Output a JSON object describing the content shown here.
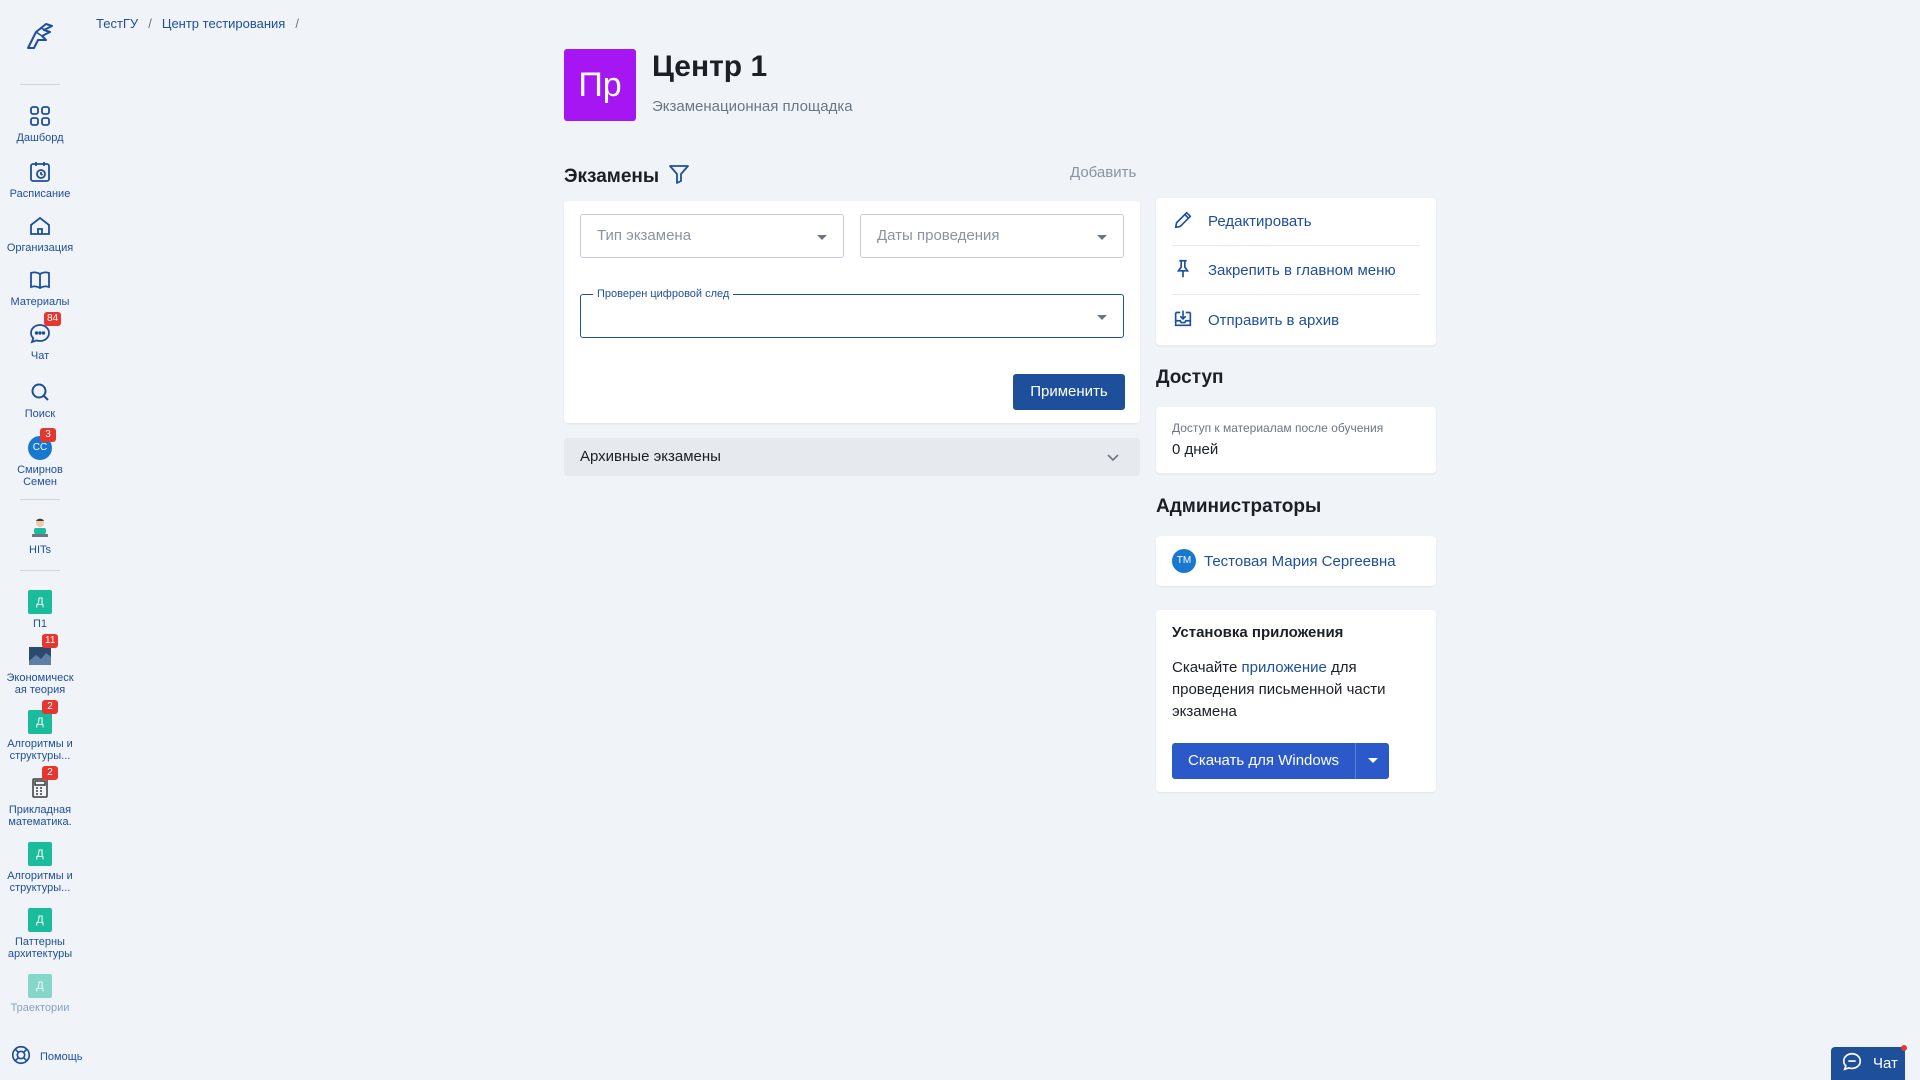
{
  "breadcrumb": {
    "items": [
      "ТестГУ",
      "Центр тестирования"
    ],
    "separator": "/"
  },
  "sidebar": {
    "nav": [
      {
        "label": "Дашборд",
        "icon": "grid-icon"
      },
      {
        "label": "Расписание",
        "icon": "calendar-clock-icon"
      },
      {
        "label": "Организация",
        "icon": "home-icon"
      },
      {
        "label": "Материалы",
        "icon": "book-icon"
      },
      {
        "label": "Чат",
        "icon": "chat-icon",
        "badge": "84"
      },
      {
        "label": "Поиск",
        "icon": "search-icon"
      },
      {
        "label1": "Смирнов",
        "label2": "Семен",
        "avatar": "СС",
        "badge": "3"
      },
      {
        "label": "HITs",
        "icon": "mascot-icon"
      }
    ],
    "courses": [
      {
        "line1": "П1",
        "line2": "",
        "initial": "Д"
      },
      {
        "line1": "Экономическ",
        "line2": "ая теория",
        "initial": "",
        "badge": "11"
      },
      {
        "line1": "Алгоритмы и",
        "line2": "структуры...",
        "initial": "Д",
        "badge": "2"
      },
      {
        "line1": "Прикладная",
        "line2": "математика.",
        "initial": "",
        "badge": "2"
      },
      {
        "line1": "Алгоритмы и",
        "line2": "структуры...",
        "initial": "Д"
      },
      {
        "line1": "Паттерны",
        "line2": "архитектуры",
        "initial": "Д"
      },
      {
        "line1": "Траектории",
        "line2": "",
        "initial": "Д"
      }
    ],
    "help": "Помощь"
  },
  "header": {
    "avatar": "Пр",
    "title": "Центр 1",
    "subtitle": "Экзаменационная площадка",
    "avatar_color": "#a616f3"
  },
  "exams": {
    "title": "Экзамены",
    "add": "Добавить",
    "filters": {
      "type_placeholder": "Тип экзамена",
      "dates_placeholder": "Даты проведения",
      "digital_label": "Проверен цифровой след",
      "digital_value": ""
    },
    "apply": "Применить",
    "archive": "Архивные экзамены"
  },
  "actions": [
    {
      "label": "Редактировать",
      "icon": "pencil-icon"
    },
    {
      "label": "Закрепить в главном меню",
      "icon": "pin-icon"
    },
    {
      "label": "Отправить в архив",
      "icon": "archive-icon"
    }
  ],
  "access": {
    "title": "Доступ",
    "label": "Доступ к материалам после обучения",
    "value": "0 дней"
  },
  "admins": {
    "title": "Администраторы",
    "items": [
      {
        "initials": "ТМ",
        "name": "Тестовая Мария Сергеевна"
      }
    ]
  },
  "install": {
    "title": "Установка приложения",
    "text_before": "Скачайте ",
    "link": "приложение",
    "text_after": " для проведения письменной части экзамена",
    "button": "Скачать для Windows"
  },
  "chat_widget": {
    "label": "Чат"
  },
  "colors": {
    "accent": "#1e4f9a",
    "course_square": "#1abc9c",
    "badge": "#e5372f",
    "download": "#2b59c9"
  }
}
